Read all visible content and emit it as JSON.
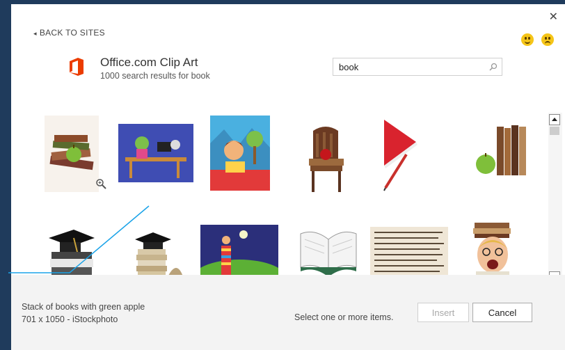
{
  "dialog": {
    "close_glyph": "✕",
    "back_label": "BACK TO SITES",
    "feedback": {
      "positive_icon": "smiley-happy-icon",
      "negative_icon": "smiley-sad-icon"
    }
  },
  "source": {
    "name": "Office.com Clip Art",
    "results_text": "1000 search results for book",
    "accent": "#eb3c00"
  },
  "search": {
    "value": "book"
  },
  "results": {
    "row1": [
      {
        "name": "books-with-apple-stack"
      },
      {
        "name": "kid-at-desk-with-computer"
      },
      {
        "name": "girl-reading-under-tree"
      },
      {
        "name": "chair-with-books-and-apple"
      },
      {
        "name": "red-book-and-pencil"
      },
      {
        "name": "apple-beside-books"
      }
    ],
    "row2": [
      {
        "name": "graduation-cap-on-books"
      },
      {
        "name": "graduation-cap-stack"
      },
      {
        "name": "child-on-book-tower"
      },
      {
        "name": "open-book"
      },
      {
        "name": "old-text-page"
      },
      {
        "name": "screaming-woman-with-books"
      }
    ]
  },
  "selection": {
    "description": "Stack of books with green apple",
    "details": "701 x 1050 - iStockphoto"
  },
  "footer": {
    "status": "Select one or more items.",
    "insert_label": "Insert",
    "cancel_label": "Cancel"
  }
}
